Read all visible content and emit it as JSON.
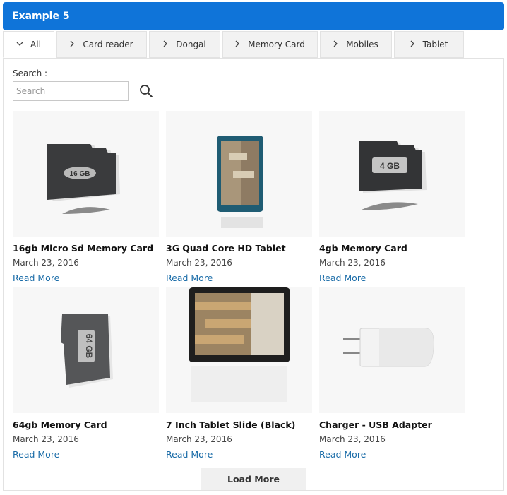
{
  "header": {
    "title": "Example 5"
  },
  "tabs": [
    {
      "label": "All",
      "icon": "chevron-down-icon",
      "active": true
    },
    {
      "label": "Card reader",
      "icon": "chevron-right-icon"
    },
    {
      "label": "Dongal",
      "icon": "chevron-right-icon"
    },
    {
      "label": "Memory Card",
      "icon": "chevron-right-icon"
    },
    {
      "label": "Mobiles",
      "icon": "chevron-right-icon"
    },
    {
      "label": "Tablet",
      "icon": "chevron-right-icon"
    }
  ],
  "search": {
    "label": "Search :",
    "placeholder": "Search",
    "value": "",
    "icon": "search-icon"
  },
  "products": [
    {
      "title": "16gb Micro Sd Memory Card",
      "date": "March 23, 2016",
      "link": "Read More",
      "image": "sd-card-16gb",
      "image_label": "16 GB"
    },
    {
      "title": "3G Quad Core HD Tablet",
      "date": "March 23, 2016",
      "link": "Read More",
      "image": "tablet-blue"
    },
    {
      "title": "4gb Memory Card",
      "date": "March 23, 2016",
      "link": "Read More",
      "image": "sd-card-4gb",
      "image_label": "4 GB"
    },
    {
      "title": "64gb Memory Card",
      "date": "March 23, 2016",
      "link": "Read More",
      "image": "sd-card-64gb",
      "image_label": "64 GB"
    },
    {
      "title": "7 Inch Tablet Slide (Black)",
      "date": "March 23, 2016",
      "link": "Read More",
      "image": "tablet-black"
    },
    {
      "title": "Charger - USB Adapter",
      "date": "March 23, 2016",
      "link": "Read More",
      "image": "usb-charger"
    }
  ],
  "load_more": {
    "label": "Load More"
  },
  "colors": {
    "accent": "#0f74d9",
    "link": "#1a6ca8",
    "tab_bg": "#f2f2f2"
  }
}
